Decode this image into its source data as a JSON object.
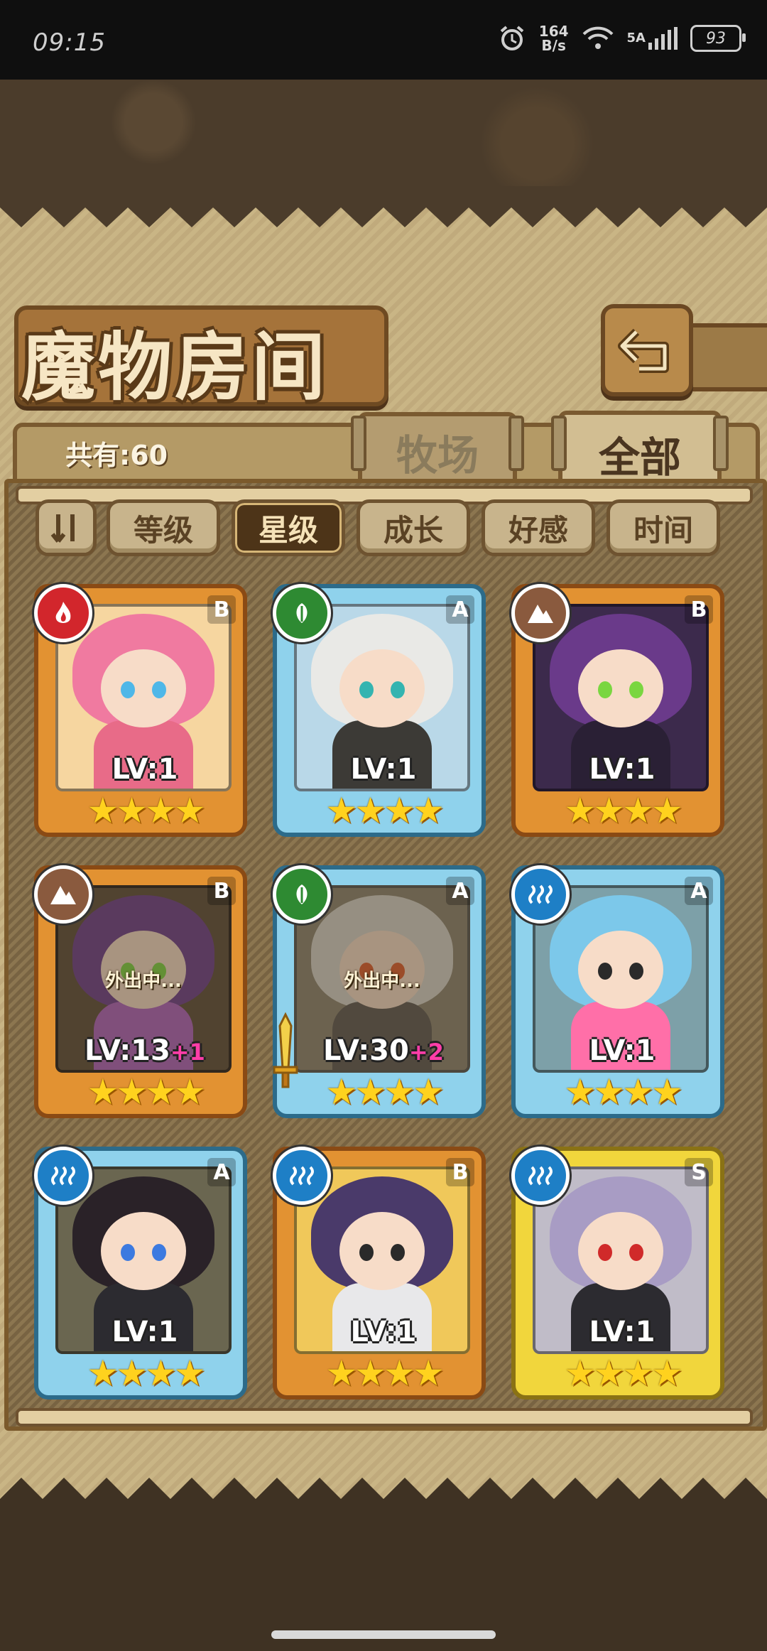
{
  "status_bar": {
    "time": "09:15",
    "net_speed_value": "164",
    "net_speed_unit": "B/s",
    "network": "5A",
    "battery": "93"
  },
  "header": {
    "title": "魔物房间"
  },
  "count_label": "共有:60",
  "tabs": [
    {
      "label": "牧场",
      "active": false
    },
    {
      "label": "全部",
      "active": true
    }
  ],
  "sort_buttons": [
    {
      "label": "等级",
      "active": false
    },
    {
      "label": "星级",
      "active": true
    },
    {
      "label": "成长",
      "active": false
    },
    {
      "label": "好感",
      "active": false
    },
    {
      "label": "时间",
      "active": false
    }
  ],
  "monsters": [
    {
      "rank": "B",
      "level": "LV:1",
      "bonus": "",
      "element": "fire",
      "frame": "orange",
      "status": "",
      "stars": "★★★★"
    },
    {
      "rank": "A",
      "level": "LV:1",
      "bonus": "",
      "element": "leaf",
      "frame": "blue",
      "status": "",
      "stars": "★★★★"
    },
    {
      "rank": "B",
      "level": "LV:1",
      "bonus": "",
      "element": "earth",
      "frame": "orange",
      "status": "",
      "stars": "★★★★"
    },
    {
      "rank": "B",
      "level": "LV:13",
      "bonus": "+1",
      "element": "earth",
      "frame": "orange",
      "status": "外出中...",
      "stars": "★★★★"
    },
    {
      "rank": "A",
      "level": "LV:30",
      "bonus": "+2",
      "element": "leaf",
      "frame": "blue",
      "status": "外出中...",
      "stars": "★★★★"
    },
    {
      "rank": "A",
      "level": "LV:1",
      "bonus": "",
      "element": "water",
      "frame": "blue",
      "status": "",
      "stars": "★★★★"
    },
    {
      "rank": "A",
      "level": "LV:1",
      "bonus": "",
      "element": "water",
      "frame": "blue",
      "status": "",
      "stars": "★★★★"
    },
    {
      "rank": "B",
      "level": "LV:1",
      "bonus": "",
      "element": "water",
      "frame": "orange",
      "status": "",
      "stars": "★★★★"
    },
    {
      "rank": "S",
      "level": "LV:1",
      "bonus": "",
      "element": "water",
      "frame": "gold",
      "status": "",
      "stars": "★★★★"
    }
  ],
  "colors": {
    "fire": "#d2262c",
    "leaf": "#2e8a32",
    "earth": "#8a5a3e",
    "water": "#1e7fc6",
    "paper": "#c9b585",
    "frame_dark": "#7b5a2c"
  }
}
